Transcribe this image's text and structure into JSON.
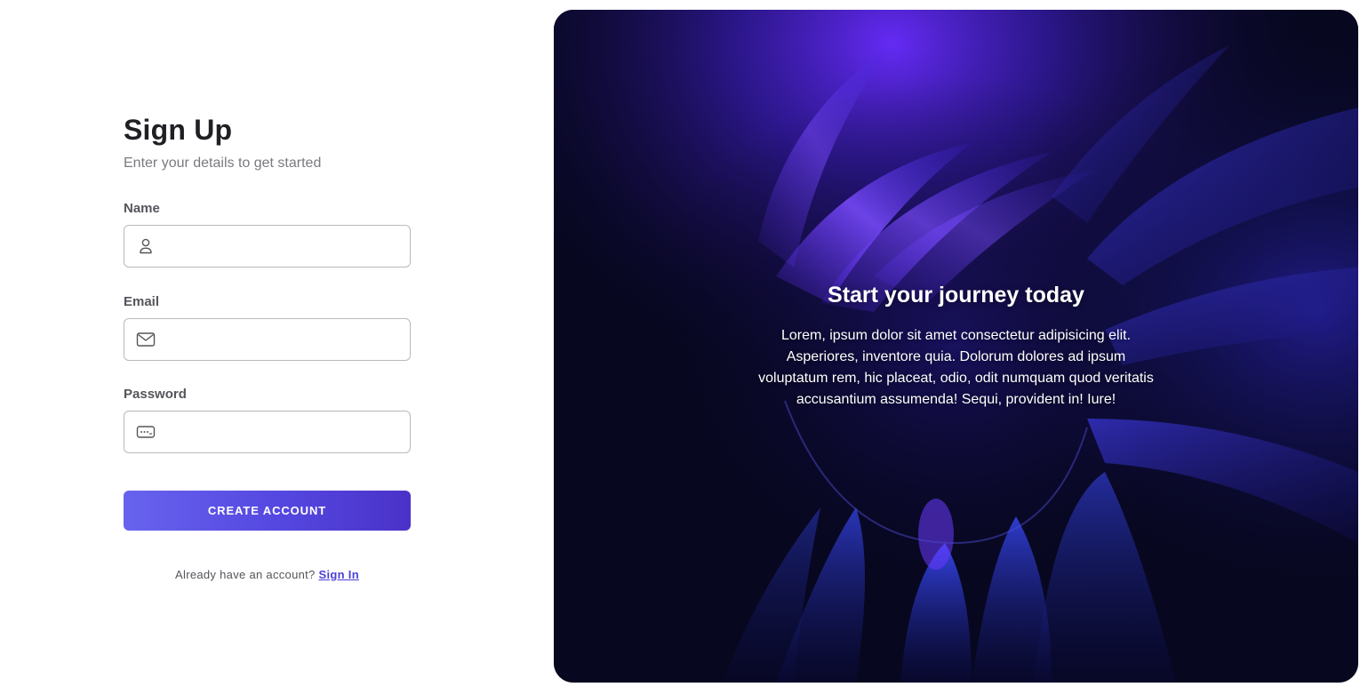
{
  "form": {
    "title": "Sign Up",
    "subtitle": "Enter your details to get started",
    "fields": {
      "name": {
        "label": "Name",
        "value": "",
        "icon": "user-icon"
      },
      "email": {
        "label": "Email",
        "value": "",
        "icon": "mail-icon"
      },
      "password": {
        "label": "Password",
        "value": "",
        "icon": "password-icon"
      }
    },
    "submit_label": "CREATE ACCOUNT",
    "signin_prompt": "Already have an account?",
    "signin_link": "Sign In"
  },
  "hero": {
    "title": "Start your journey today",
    "body": "Lorem, ipsum dolor sit amet consectetur adipisicing elit. Asperiores, inventore quia. Dolorum dolores ad ipsum voluptatum rem, hic placeat, odio, odit numquam quod veritatis accusantium assumenda! Sequi, provident in! Iure!"
  },
  "colors": {
    "accent": "#5447e0",
    "link": "#4b3fd8",
    "hero_background": "#07071f",
    "hero_glow": "#6a2cff"
  }
}
